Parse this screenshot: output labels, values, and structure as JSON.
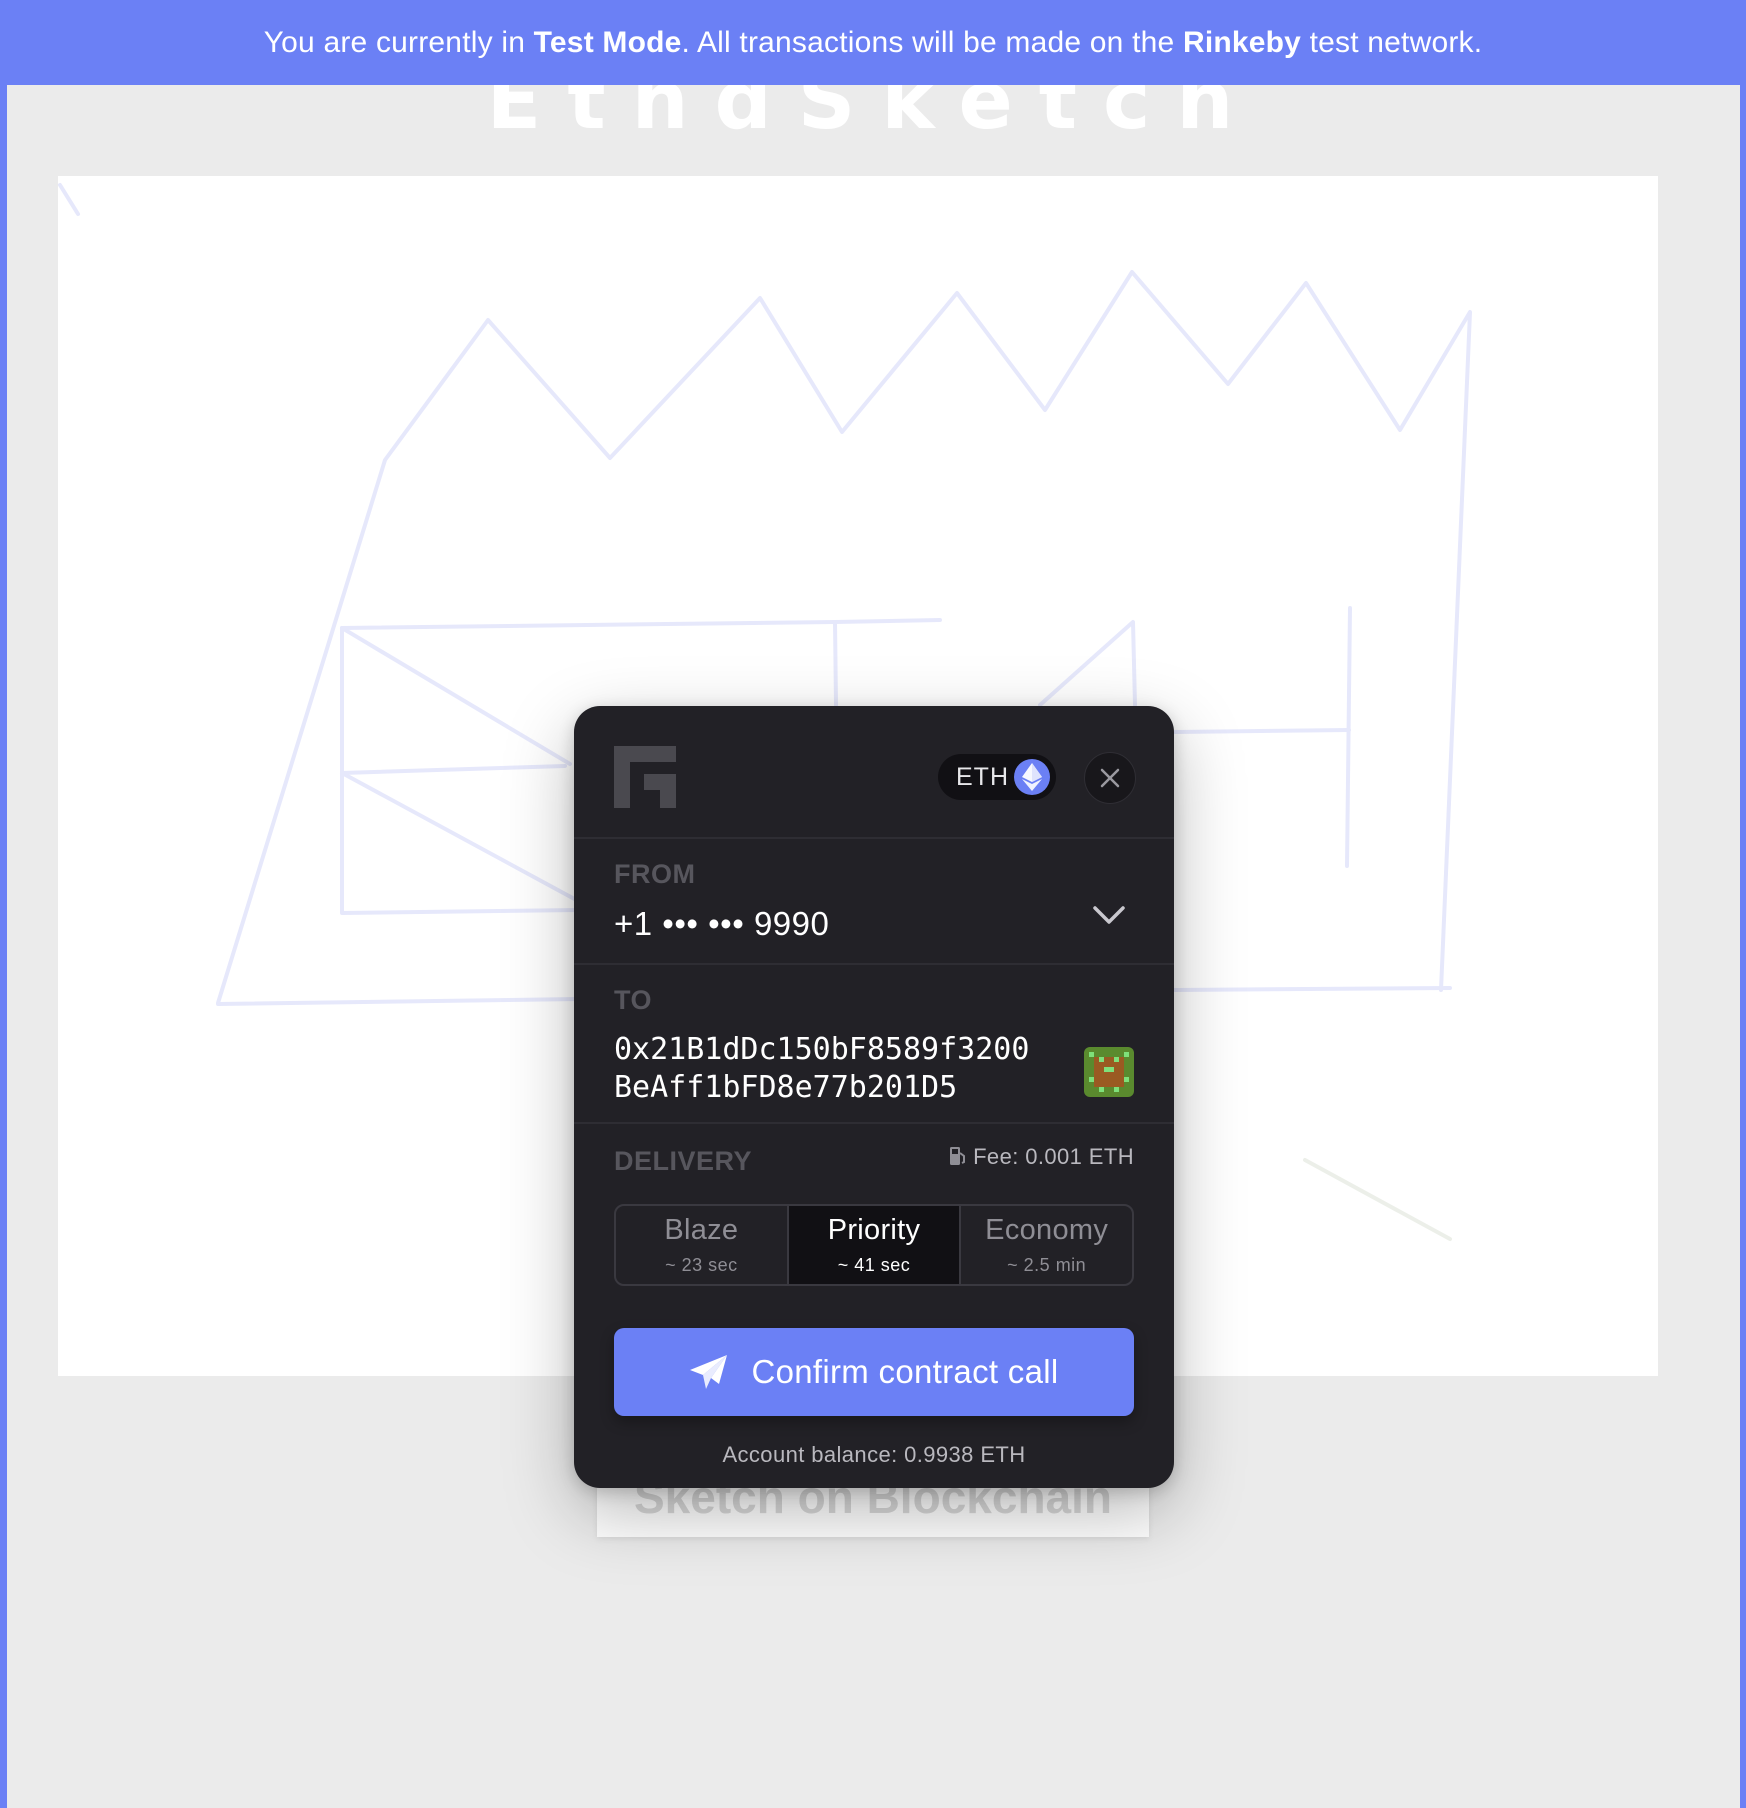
{
  "banner": {
    "prefix": "You are currently in ",
    "mode": "Test Mode",
    "middle": ". All transactions will be made on the ",
    "network": "Rinkeby",
    "suffix": " test network."
  },
  "site": {
    "title": "EthdSketch",
    "bottom_button_label": "Sketch on Blockchain"
  },
  "modal": {
    "token_label": "ETH",
    "token_icon": "ethereum-icon",
    "from": {
      "label": "FROM",
      "value": "+1 ••• ••• 9990"
    },
    "to": {
      "label": "TO",
      "address": "0x21B1dDc150bF8589f3200BeAff1bFD8e77b201D5"
    },
    "delivery": {
      "label": "DELIVERY",
      "fee": "Fee: 0.001 ETH",
      "options": [
        {
          "name": "Blaze",
          "time": "~ 23 sec",
          "selected": false
        },
        {
          "name": "Priority",
          "time": "~ 41 sec",
          "selected": true
        },
        {
          "name": "Economy",
          "time": "~ 2.5 min",
          "selected": false
        }
      ]
    },
    "confirm_label": "Confirm contract call",
    "balance": "Account balance: 0.9938 ETH"
  },
  "colors": {
    "accent": "#6b80f5",
    "modal_bg": "#222126",
    "page_bg": "#ebebeb",
    "sketch_line": "#e6e8fb"
  }
}
